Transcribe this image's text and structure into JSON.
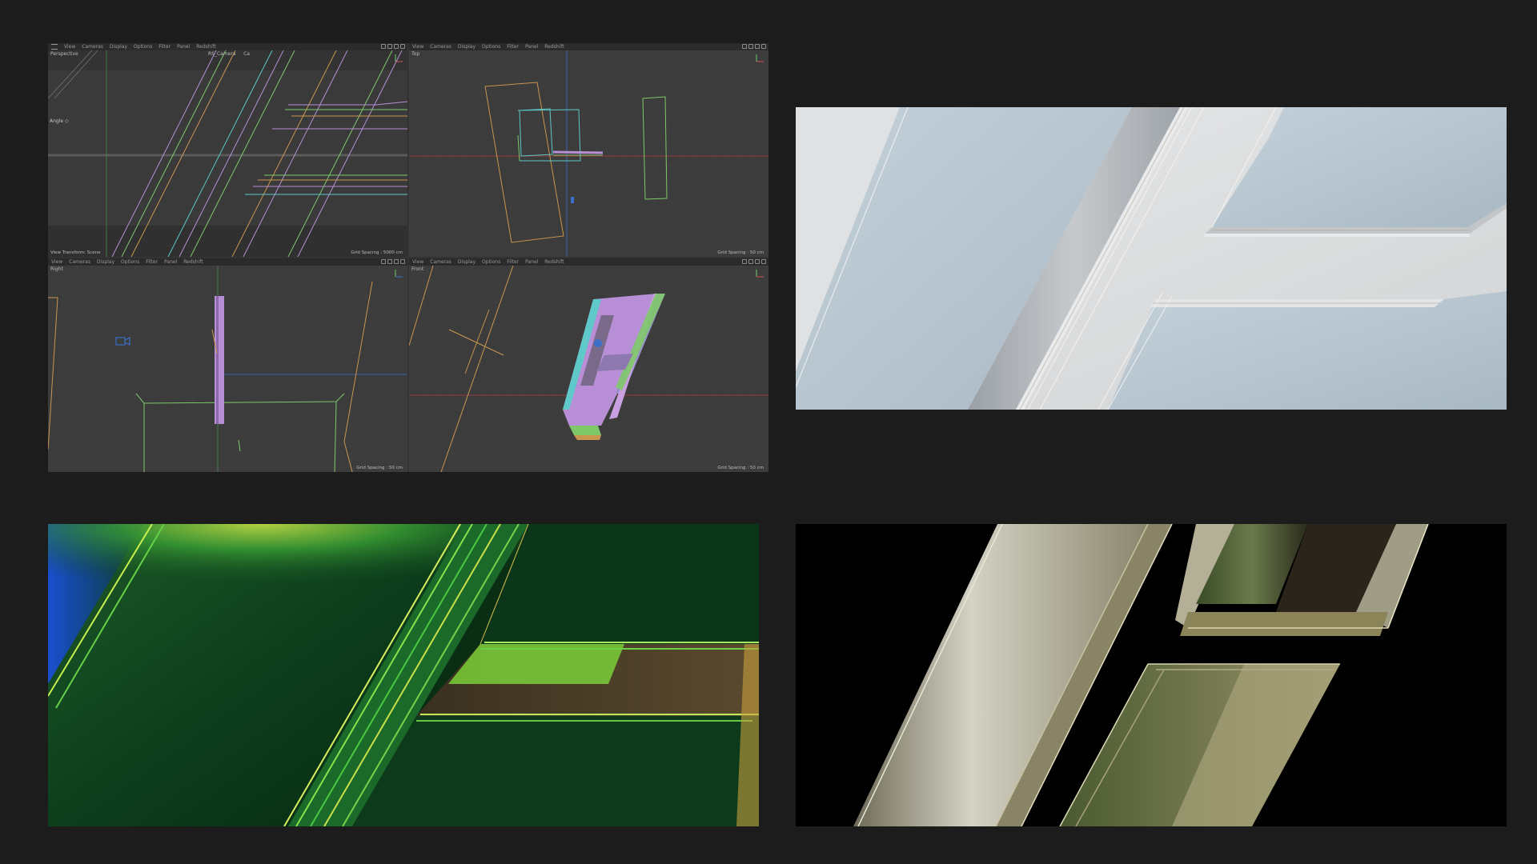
{
  "viewports": {
    "perspective": {
      "menu": [
        "View",
        "Cameras",
        "Display",
        "Options",
        "Filter",
        "Panel",
        "Redshift"
      ],
      "name": "Perspective",
      "camera": "RS_Camera",
      "camera_suffix": "Ca",
      "status_left": "View Transform: Scene",
      "grid_spacing": "Grid Spacing : 5000 cm",
      "angle_label": "Angle"
    },
    "top": {
      "menu": [
        "View",
        "Cameras",
        "Display",
        "Options",
        "Filter",
        "Panel",
        "Redshift"
      ],
      "name": "Top",
      "grid_spacing": "Grid Spacing : 50 cm"
    },
    "right": {
      "menu": [
        "View",
        "Cameras",
        "Display",
        "Options",
        "Filter",
        "Panel",
        "Redshift"
      ],
      "name": "Right",
      "grid_spacing": "Grid Spacing : 50 cm"
    },
    "front": {
      "menu": [
        "View",
        "Cameras",
        "Display",
        "Options",
        "Filter",
        "Panel",
        "Redshift"
      ],
      "name": "Front",
      "grid_spacing": "Grid Spacing : 50 cm"
    }
  },
  "colors": {
    "page_bg": "#1c1c1c",
    "viewport_bg": "#3c3c3c",
    "menubar_bg": "#2b2b2b",
    "wire_purple": "#b88fd6",
    "wire_green": "#7ec86a",
    "wire_orange": "#c9964f",
    "wire_cyan": "#5fc8c8",
    "render_light_bg": "#d8dadb",
    "render_light_glass": "#b7c6d0",
    "render_green": "#0c4a1e",
    "render_dark_bg": "#000000"
  },
  "icons": [
    "menu-icon",
    "camera-icon",
    "axis-gizmo-icon",
    "viewport-control-icon"
  ]
}
